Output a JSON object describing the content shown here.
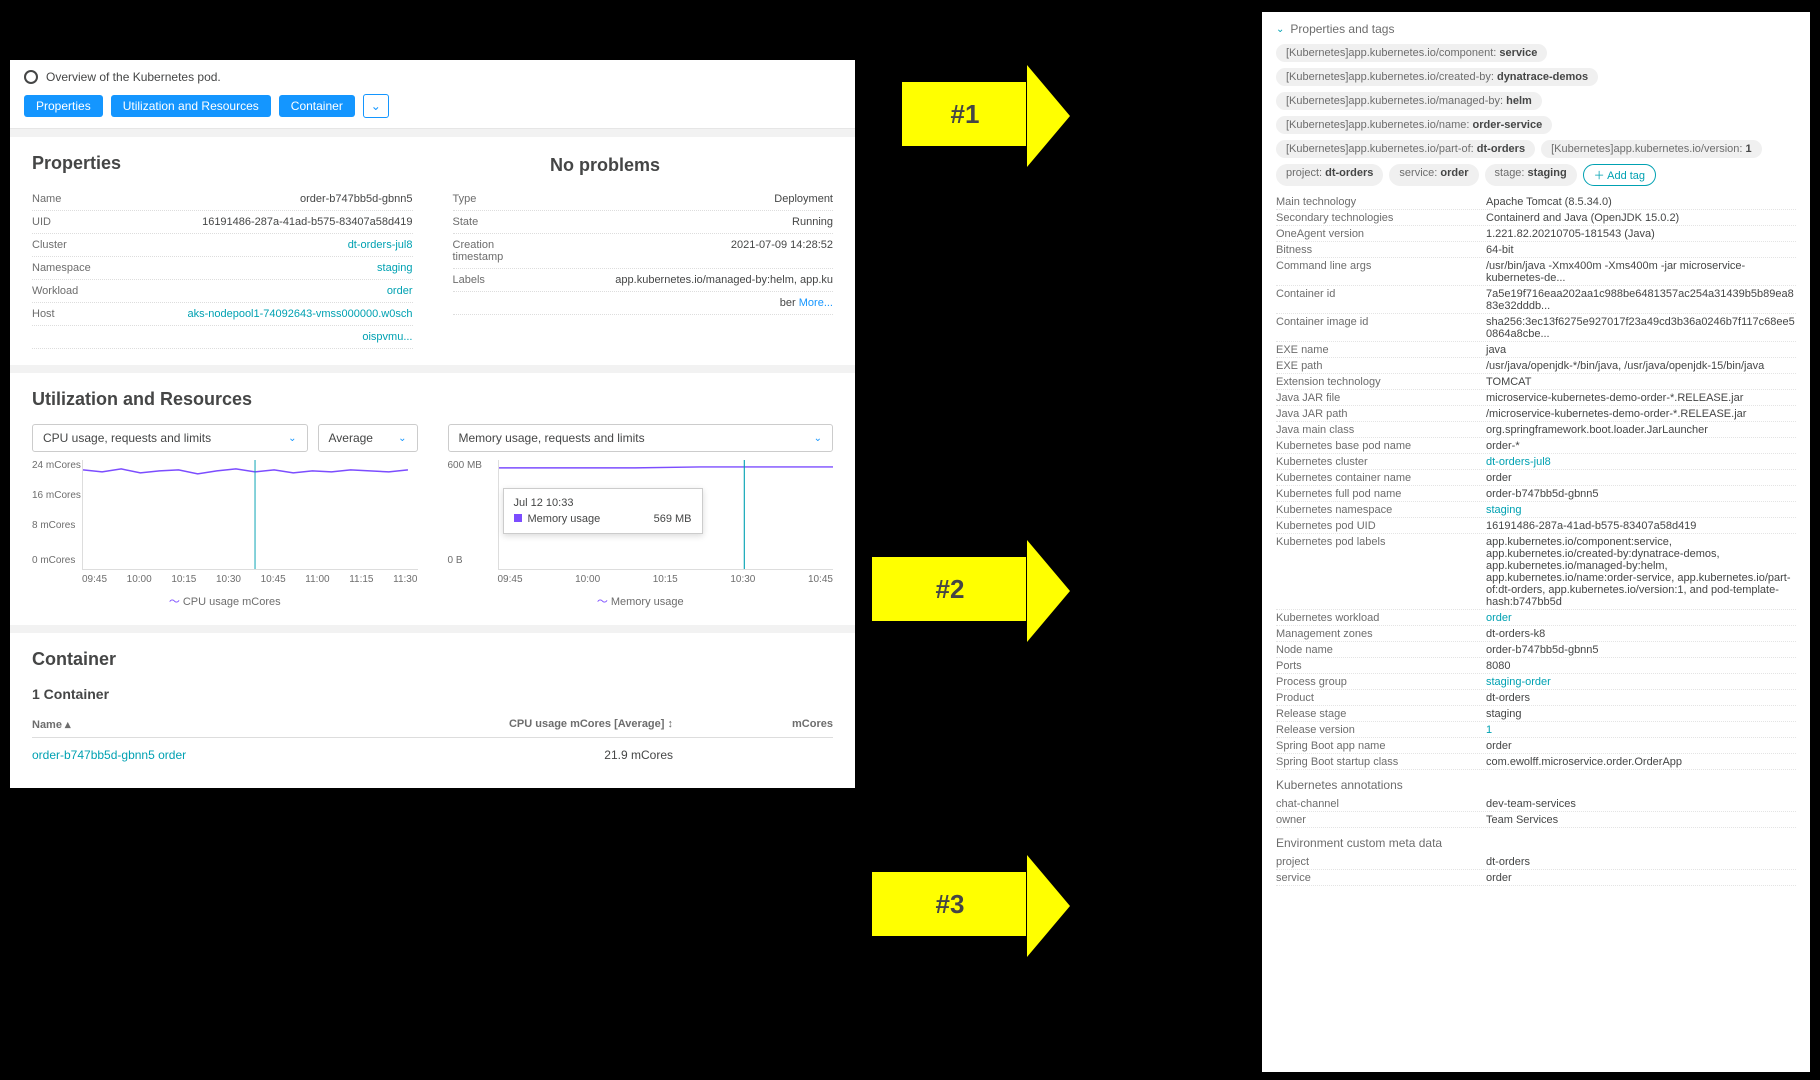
{
  "header": {
    "title": "Overview of the Kubernetes pod.",
    "tabs": [
      "Properties",
      "Utilization and Resources",
      "Container"
    ]
  },
  "properties": {
    "heading": "Properties",
    "noproblems": "No problems",
    "left": [
      {
        "label": "Name",
        "value": "order-b747bb5d-gbnn5",
        "link": false
      },
      {
        "label": "UID",
        "value": "16191486-287a-41ad-b575-83407a58d419",
        "link": false
      },
      {
        "label": "Cluster",
        "value": "dt-orders-jul8",
        "link": true
      },
      {
        "label": "Namespace",
        "value": "staging",
        "link": true
      },
      {
        "label": "Workload",
        "value": "order",
        "link": true
      },
      {
        "label": "Host",
        "value": "aks-nodepool1-74092643-vmss000000.w0sch",
        "link": true
      },
      {
        "label": "",
        "value": "oispvmu...",
        "link": true
      }
    ],
    "right": [
      {
        "label": "Type",
        "value": "Deployment",
        "link": false
      },
      {
        "label": "State",
        "value": "Running",
        "link": false
      },
      {
        "label": "Creation timestamp",
        "value": "2021-07-09 14:28:52",
        "link": false
      },
      {
        "label": "Labels",
        "value": "app.kubernetes.io/managed-by:helm, app.ku",
        "link": false
      },
      {
        "label": "",
        "value": "ber",
        "link": false,
        "more": "More..."
      }
    ]
  },
  "util": {
    "heading": "Utilization and Resources",
    "cpu_sel": "CPU usage, requests and limits",
    "avg_sel": "Average",
    "mem_sel": "Memory usage, requests and limits",
    "chart_data": {
      "cpu": {
        "type": "line",
        "title": "",
        "ylabel": "",
        "ylim": [
          0,
          24
        ],
        "yunit": "mCores",
        "yticks": [
          "24 mCores",
          "16 mCores",
          "8 mCores",
          "0 mCores"
        ],
        "x": [
          "09:45",
          "10:00",
          "10:15",
          "10:30",
          "10:45",
          "11:00",
          "11:15",
          "11:30"
        ],
        "series": [
          {
            "name": "CPU usage mCores",
            "values": [
              22,
              22,
              21,
              22,
              23,
              22,
              22,
              22
            ]
          }
        ],
        "legend": "CPU usage mCores"
      },
      "mem": {
        "type": "line",
        "title": "",
        "ylabel": "",
        "ylim": [
          0,
          600
        ],
        "yunit": "MB",
        "yticks": [
          "600 MB",
          "0 B"
        ],
        "x": [
          "09:45",
          "10:00",
          "10:15",
          "10:30",
          "10:45"
        ],
        "series": [
          {
            "name": "Memory usage",
            "values": [
              560,
              565,
              565,
              569,
              569
            ]
          }
        ],
        "legend": "Memory usage",
        "tooltip": {
          "time": "Jul 12 10:33",
          "label": "Memory usage",
          "value": "569 MB"
        }
      }
    }
  },
  "container": {
    "heading": "Container",
    "sub": "1 Container",
    "cols": {
      "name": "Name ▴",
      "cpu": "CPU usage mCores [Average] ↕",
      "mem": "mCores"
    },
    "rows": [
      {
        "name": "order-b747bb5d-gbnn5 order",
        "cpu": "21.9 mCores",
        "mem": ""
      }
    ]
  },
  "right_panel": {
    "header": "Properties and tags",
    "tags": [
      {
        "prefix": "[Kubernetes]app.kubernetes.io/component:",
        "value": "service"
      },
      {
        "prefix": "[Kubernetes]app.kubernetes.io/created-by:",
        "value": "dynatrace-demos"
      },
      {
        "prefix": "[Kubernetes]app.kubernetes.io/managed-by:",
        "value": "helm"
      },
      {
        "prefix": "[Kubernetes]app.kubernetes.io/name:",
        "value": "order-service"
      },
      {
        "prefix": "[Kubernetes]app.kubernetes.io/part-of:",
        "value": "dt-orders"
      },
      {
        "prefix": "[Kubernetes]app.kubernetes.io/version:",
        "value": "1"
      },
      {
        "prefix": "project:",
        "value": "dt-orders"
      },
      {
        "prefix": "service:",
        "value": "order"
      },
      {
        "prefix": "stage:",
        "value": "staging"
      }
    ],
    "add_tag": "Add tag",
    "details": [
      {
        "label": "Main technology",
        "value": "Apache Tomcat (8.5.34.0)"
      },
      {
        "label": "Secondary technologies",
        "value": "Containerd and Java (OpenJDK 15.0.2)"
      },
      {
        "label": "OneAgent version",
        "value": "1.221.82.20210705-181543 (Java)"
      },
      {
        "label": "Bitness",
        "value": "64-bit"
      },
      {
        "label": "Command line args",
        "value": "/usr/bin/java -Xmx400m -Xms400m -jar microservice-kubernetes-de..."
      },
      {
        "label": "Container id",
        "value": "7a5e19f716eaa202aa1c988be6481357ac254a31439b5b89ea883e32dddb..."
      },
      {
        "label": "Container image id",
        "value": "sha256:3ec13f6275e927017f23a49cd3b36a0246b7f117c68ee50864a8cbe..."
      },
      {
        "label": "EXE name",
        "value": "java"
      },
      {
        "label": "EXE path",
        "value": "/usr/java/openjdk-*/bin/java, /usr/java/openjdk-15/bin/java"
      },
      {
        "label": "Extension technology",
        "value": "TOMCAT"
      },
      {
        "label": "Java JAR file",
        "value": "microservice-kubernetes-demo-order-*.RELEASE.jar"
      },
      {
        "label": "Java JAR path",
        "value": "/microservice-kubernetes-demo-order-*.RELEASE.jar"
      },
      {
        "label": "Java main class",
        "value": "org.springframework.boot.loader.JarLauncher"
      },
      {
        "label": "Kubernetes base pod name",
        "value": "order-*"
      },
      {
        "label": "Kubernetes cluster",
        "value": "dt-orders-jul8",
        "link": true
      },
      {
        "label": "Kubernetes container name",
        "value": "order"
      },
      {
        "label": "Kubernetes full pod name",
        "value": "order-b747bb5d-gbnn5"
      },
      {
        "label": "Kubernetes namespace",
        "value": "staging",
        "link": true
      },
      {
        "label": "Kubernetes pod UID",
        "value": "16191486-287a-41ad-b575-83407a58d419"
      },
      {
        "label": "Kubernetes pod labels",
        "value": "app.kubernetes.io/component:service, app.kubernetes.io/created-by:dynatrace-demos, app.kubernetes.io/managed-by:helm, app.kubernetes.io/name:order-service, app.kubernetes.io/part-of:dt-orders, app.kubernetes.io/version:1, and pod-template-hash:b747bb5d"
      },
      {
        "label": "Kubernetes workload",
        "value": "order",
        "link": true
      },
      {
        "label": "Management zones",
        "value": "dt-orders-k8"
      },
      {
        "label": "Node name",
        "value": "order-b747bb5d-gbnn5"
      },
      {
        "label": "Ports",
        "value": "8080"
      },
      {
        "label": "Process group",
        "value": "staging-order",
        "link": true
      },
      {
        "label": "Product",
        "value": "dt-orders"
      },
      {
        "label": "Release stage",
        "value": "staging"
      },
      {
        "label": "Release version",
        "value": "1",
        "link": true
      },
      {
        "label": "Spring Boot app name",
        "value": "order"
      },
      {
        "label": "Spring Boot startup class",
        "value": "com.ewolff.microservice.order.OrderApp"
      }
    ],
    "annotations_h": "Kubernetes annotations",
    "annotations": [
      {
        "label": "chat-channel",
        "value": "dev-team-services"
      },
      {
        "label": "owner",
        "value": "Team Services"
      }
    ],
    "envmeta_h": "Environment custom meta data",
    "envmeta": [
      {
        "label": "project",
        "value": "dt-orders"
      },
      {
        "label": "service",
        "value": "order"
      }
    ]
  },
  "arrows": {
    "a1": "#1",
    "a2": "#2",
    "a3": "#3"
  }
}
